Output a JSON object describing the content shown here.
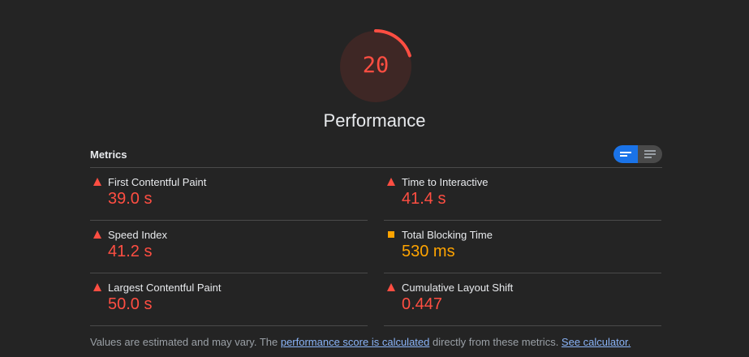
{
  "score": {
    "value": "20",
    "fraction": 0.2,
    "color": "#ff4e42",
    "track_color": "#3e2725"
  },
  "category_title": "Performance",
  "metrics": {
    "heading": "Metrics",
    "view_toggle": {
      "selected": "condensed",
      "options": [
        "condensed-view-icon",
        "expanded-view-icon"
      ]
    },
    "items": [
      {
        "label": "First Contentful Paint",
        "value": "39.0 s",
        "status": "fail",
        "icon": "red-triangle-icon"
      },
      {
        "label": "Time to Interactive",
        "value": "41.4 s",
        "status": "fail",
        "icon": "red-triangle-icon"
      },
      {
        "label": "Speed Index",
        "value": "41.2 s",
        "status": "fail",
        "icon": "red-triangle-icon"
      },
      {
        "label": "Total Blocking Time",
        "value": "530 ms",
        "status": "average",
        "icon": "orange-square-icon"
      },
      {
        "label": "Largest Contentful Paint",
        "value": "50.0 s",
        "status": "fail",
        "icon": "red-triangle-icon"
      },
      {
        "label": "Cumulative Layout Shift",
        "value": "0.447",
        "status": "fail",
        "icon": "red-triangle-icon"
      }
    ]
  },
  "footer": {
    "text_before": "Values are estimated and may vary. The ",
    "link1": "performance score is calculated",
    "text_middle": " directly from these metrics. ",
    "link2": "See calculator."
  },
  "colors": {
    "background": "#242424",
    "fail": "#ff4e42",
    "average": "#ffa400",
    "accent": "#1a73e8",
    "link": "#8ab4f8"
  }
}
